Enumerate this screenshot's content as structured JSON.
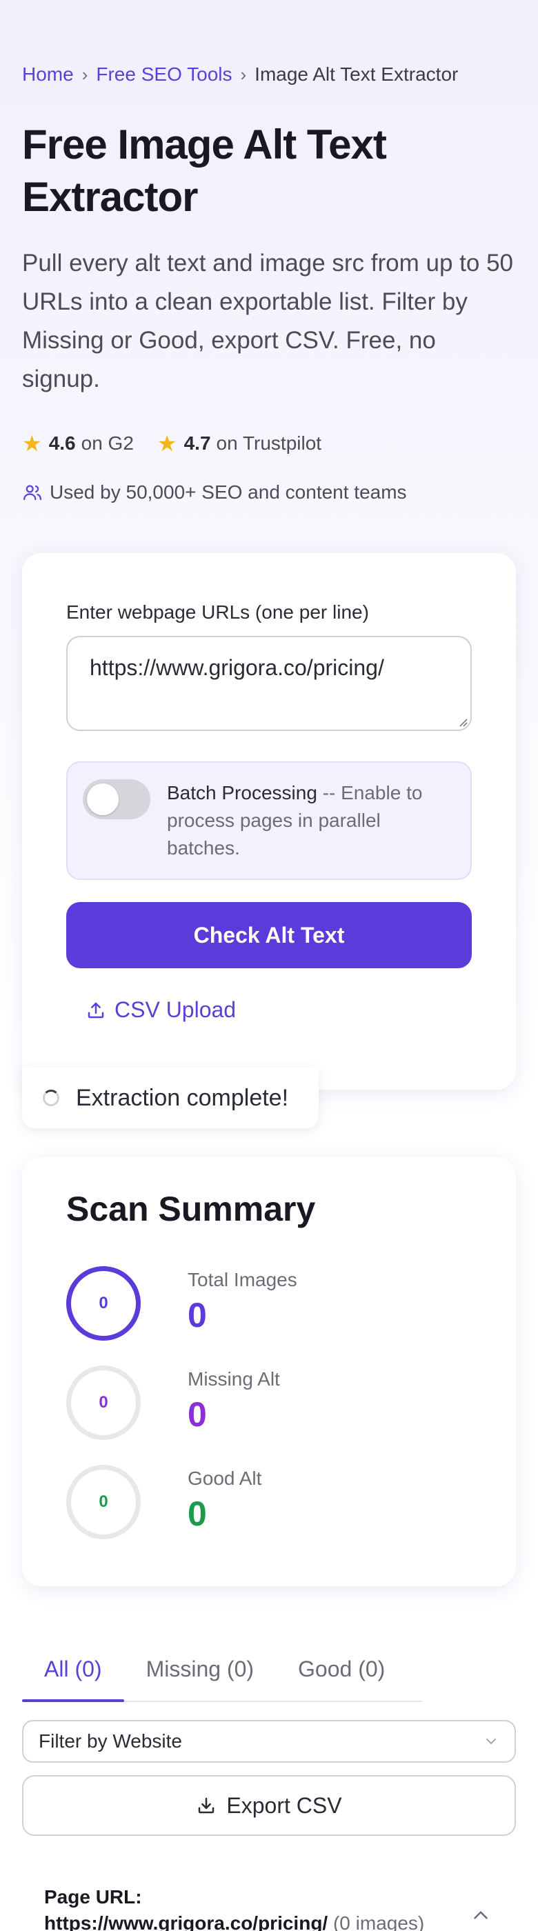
{
  "breadcrumb": {
    "home": "Home",
    "tools": "Free SEO Tools",
    "current": "Image Alt Text Extractor",
    "separator": "›"
  },
  "hero": {
    "title": "Free Image Alt Text Extractor",
    "description": "Pull every alt text and image src from up to 50 URLs into a clean exportable list. Filter by Missing or Good, export CSV. Free, no signup."
  },
  "ratings": [
    {
      "score": "4.6",
      "source": "on G2"
    },
    {
      "score": "4.7",
      "source": "on Trustpilot"
    }
  ],
  "social_proof": "Used by 50,000+ SEO and content teams",
  "form": {
    "url_label": "Enter webpage URLs (one per line)",
    "url_value": "https://www.grigora.co/pricing/",
    "batch_title": "Batch Processing",
    "batch_desc": " -- Enable to process pages in parallel batches.",
    "batch_enabled": false,
    "check_button": "Check Alt Text",
    "csv_upload": "CSV Upload"
  },
  "toast": "Extraction complete!",
  "summary": {
    "title": "Scan Summary",
    "stats": [
      {
        "label": "Total Images",
        "ring": "0",
        "value": "0",
        "color": "#5b3bd9"
      },
      {
        "label": "Missing Alt",
        "ring": "0",
        "value": "0",
        "color": "#8b2fd6"
      },
      {
        "label": "Good Alt",
        "ring": "0",
        "value": "0",
        "color": "#1a9a4a"
      }
    ]
  },
  "tabs": [
    "All (0)",
    "Missing (0)",
    "Good (0)"
  ],
  "active_tab": "All (0)",
  "filter": {
    "selected": "Filter by Website"
  },
  "export_button": "Export CSV",
  "result": {
    "page_url_label": "Page URL:",
    "page_url": "https://www.grigora.co/pricing/",
    "image_count": "(0 images)"
  },
  "colors": {
    "accent": "#5b3bd9",
    "star": "#f2b51c"
  }
}
